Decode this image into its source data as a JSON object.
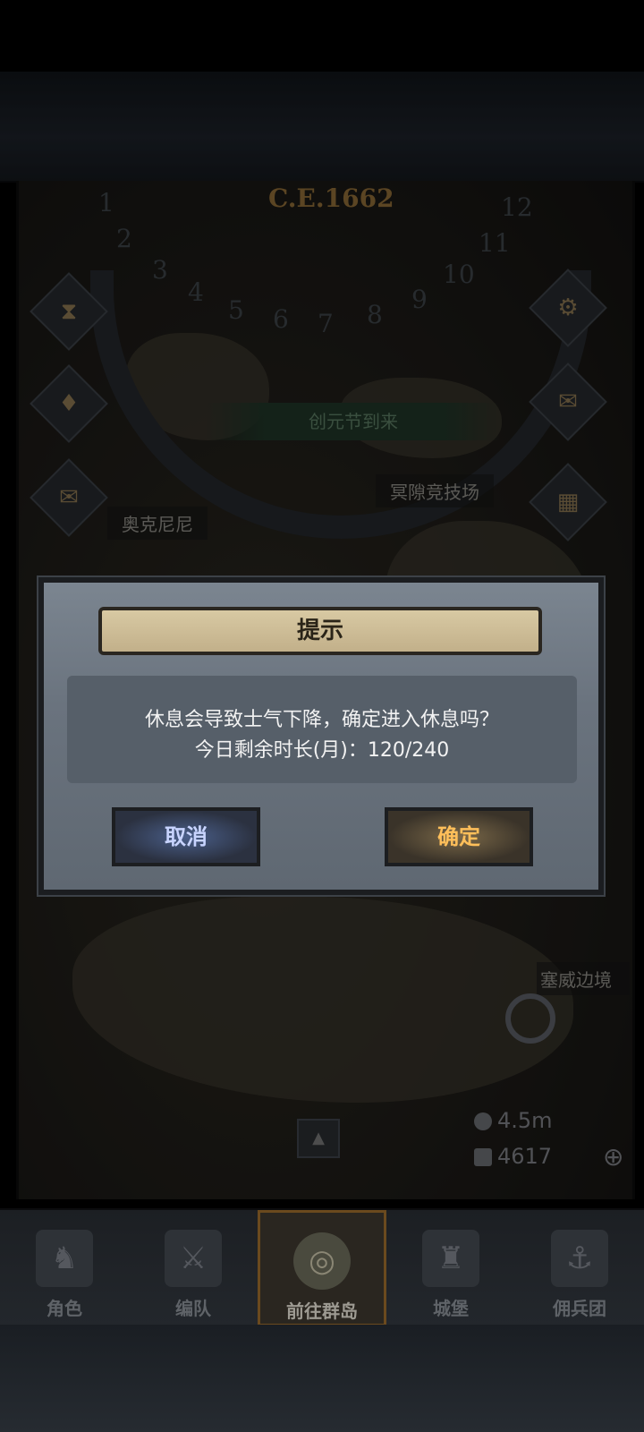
{
  "map": {
    "year": "C.E.1662",
    "months": [
      "1",
      "2",
      "3",
      "4",
      "5",
      "6",
      "7",
      "8",
      "9",
      "10",
      "11",
      "12"
    ],
    "event_banner": "创元节到来",
    "places": {
      "left_castle": "奥克尼尼",
      "arena": "冥隙竞技场",
      "border": "塞威边境"
    },
    "resources": {
      "silver": "4.5m",
      "gems": "4617"
    },
    "icons": {
      "left": [
        "hourglass-icon",
        "bag-icon",
        "scroll-icon"
      ],
      "right": [
        "gear-icon",
        "mail-icon",
        "grid-icon"
      ]
    }
  },
  "dialog": {
    "title": "提示",
    "message": "休息会导致士气下降，确定进入休息吗？",
    "remaining": "今日剩余时长(月)：120/240",
    "cancel_label": "取消",
    "confirm_label": "确定"
  },
  "nav": {
    "items": [
      {
        "label": "角色"
      },
      {
        "label": "编队"
      },
      {
        "label": "前往群岛"
      },
      {
        "label": "城堡"
      },
      {
        "label": "佣兵团"
      }
    ],
    "active_index": 2
  }
}
